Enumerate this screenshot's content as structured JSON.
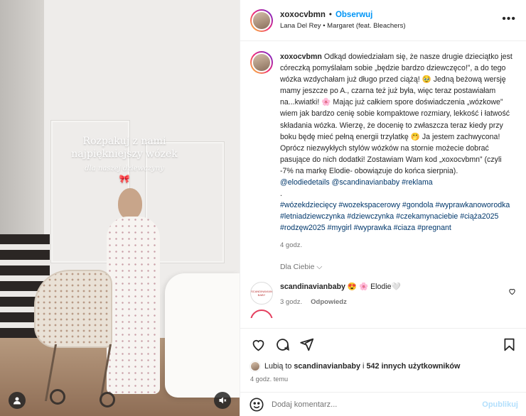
{
  "media": {
    "overlay_title": "Rozpakuj z nami najpiękniejszy wózek",
    "overlay_subtitle": "dla naszej dziewczyny",
    "overlay_emoji": "🎀"
  },
  "header": {
    "username": "xoxocvbmn",
    "separator": "•",
    "follow_label": "Obserwuj",
    "song": "Lana Del Rey • Margaret (feat. Bleachers)",
    "more_label": "•••"
  },
  "caption": {
    "username": "xoxocvbmn",
    "text": "Odkąd dowiedziałam się, że nasze drugie dzieciątko jest córeczką pomyślałam sobie „będzie bardzo dziewczęco!”, a do tego wózka wzdychałam już długo przed ciążą! 🥹 Jedną beżową wersję mamy jeszcze po A., czarna też już była, więc teraz postawiałam na...kwiatki! 🌸 Mając już całkiem spore doświadczenia „wózkowe” wiem jak bardzo cenię sobie kompaktowe rozmiary, lekkość i łatwość składania wózka. Wierzę, że docenię to zwłaszcza teraz kiedy przy boku będę mieć pełną energii trzylatkę 🤭 Ja jestem zachwycona! Oprócz niezwykłych stylów wózków na stornie możecie dobrać pasujące do nich dodatki! Zostawiam Wam kod „xoxocvbmn” (czyli -7% na markę Elodie- obowiązuje do końca sierpnia).",
    "mentions": "@elodiedetails @scandinavianbaby #reklama",
    "dot": ".",
    "hashtags": "#wózekdziecięcy #wozekspacerowy #gondola #wyprawkanoworodka #letniadziewczynka #dziewczynka #czekamynaciebie #ciąża2025 #rodzęw2025 #mygirl #wyprawka #ciaza #pregnant",
    "time": "4 godz."
  },
  "for_you_label": "Dla Ciebie",
  "comment": {
    "avatar_text": "SCANDINAVIAN BABY",
    "username": "scandinavianbaby",
    "text": "😍 🌸 Elodie🤍",
    "time": "3 godz.",
    "reply_label": "Odpowiedz"
  },
  "likes": {
    "prefix": "Lubią to",
    "user": "scandinavianbaby",
    "middle": "i",
    "count": "542 innych użytkowników"
  },
  "post_time": "4 godz. temu",
  "composer": {
    "placeholder": "Dodaj komentarz...",
    "publish_label": "Opublikuj"
  },
  "icons": {
    "like": "heart-icon",
    "comment": "comment-icon",
    "share": "share-icon",
    "save": "bookmark-icon",
    "emoji": "emoji-icon",
    "mute": "muted-icon",
    "tags": "user-tag-icon"
  }
}
